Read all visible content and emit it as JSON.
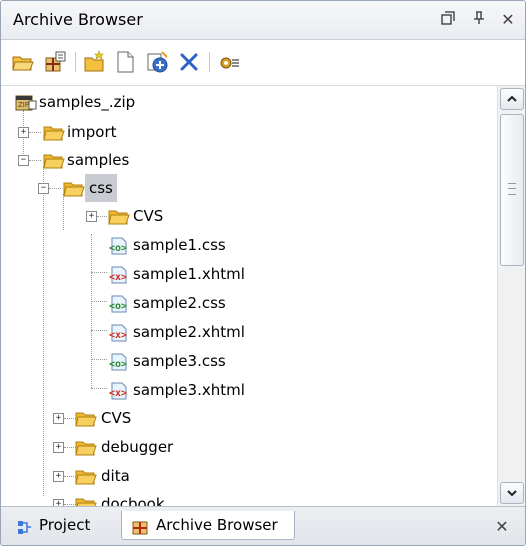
{
  "window": {
    "title": "Archive Browser",
    "controls": [
      "restore-icon",
      "pin-icon",
      "close-icon"
    ],
    "close_glyph": "✕",
    "pin_glyph": "ᵖ"
  },
  "toolbar": {
    "buttons": [
      "open-archive-icon",
      "new-archive-icon",
      "new-folder-icon",
      "new-file-icon",
      "add-files-icon",
      "delete-icon",
      "properties-icon"
    ]
  },
  "tree": {
    "items": [
      {
        "label": "samples_.zip",
        "type": "archive"
      },
      {
        "label": "import",
        "type": "folder",
        "expander": "+"
      },
      {
        "label": "samples",
        "type": "folder",
        "expander": "-"
      },
      {
        "label": "css",
        "type": "folder",
        "expander": "-",
        "selected": true
      },
      {
        "label": "CVS",
        "type": "folder",
        "expander": "+"
      },
      {
        "label": "sample1.css",
        "type": "css"
      },
      {
        "label": "sample1.xhtml",
        "type": "xhtml"
      },
      {
        "label": "sample2.css",
        "type": "css"
      },
      {
        "label": "sample2.xhtml",
        "type": "xhtml"
      },
      {
        "label": "sample3.css",
        "type": "css"
      },
      {
        "label": "sample3.xhtml",
        "type": "xhtml"
      },
      {
        "label": "CVS",
        "type": "folder",
        "expander": "+"
      },
      {
        "label": "debugger",
        "type": "folder",
        "expander": "+"
      },
      {
        "label": "dita",
        "type": "folder",
        "expander": "+"
      },
      {
        "label": "docbook",
        "type": "folder",
        "expander": "+"
      }
    ]
  },
  "tabs": [
    {
      "label": "Project",
      "active": false
    },
    {
      "label": "Archive Browser",
      "active": true
    }
  ],
  "tabs_close_glyph": "✕",
  "colors": {
    "folder": "#f5c94b",
    "css": "#3a9a3a",
    "xhtml": "#d33a2c",
    "selection": "#c9cbd2"
  }
}
